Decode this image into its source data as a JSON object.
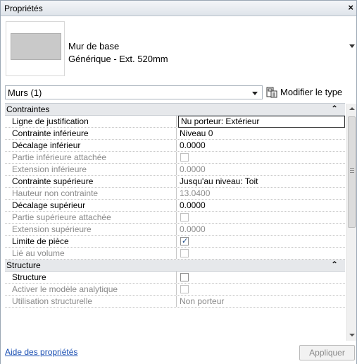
{
  "window": {
    "title": "Propriétés",
    "close_glyph": "×"
  },
  "type_selector": {
    "family": "Mur de base",
    "type": "Générique - Ext. 520mm"
  },
  "instance_filter": {
    "label": "Murs (1)"
  },
  "edit_type_button": {
    "label": "Modifier le type"
  },
  "groups": [
    {
      "name": "Contraintes",
      "collapse_glyph": "⌃"
    },
    {
      "name": "Structure",
      "collapse_glyph": "⌃"
    }
  ],
  "properties": [
    {
      "name": "Ligne de justification",
      "value": "Nu porteur: Extérieur",
      "enabled": true,
      "kind": "text"
    },
    {
      "name": "Contrainte inférieure",
      "value": "Niveau 0",
      "enabled": true,
      "kind": "text"
    },
    {
      "name": "Décalage inférieur",
      "value": "0.0000",
      "enabled": true,
      "kind": "text"
    },
    {
      "name": "Partie inférieure attachée",
      "value": "",
      "enabled": false,
      "kind": "checkbox",
      "checked": false
    },
    {
      "name": "Extension inférieure",
      "value": "0.0000",
      "enabled": false,
      "kind": "text"
    },
    {
      "name": "Contrainte supérieure",
      "value": "Jusqu'au niveau: Toit",
      "enabled": true,
      "kind": "text"
    },
    {
      "name": "Hauteur non contrainte",
      "value": "13.0400",
      "enabled": false,
      "kind": "text"
    },
    {
      "name": "Décalage supérieur",
      "value": "0.0000",
      "enabled": true,
      "kind": "text"
    },
    {
      "name": "Partie supérieure attachée",
      "value": "",
      "enabled": false,
      "kind": "checkbox",
      "checked": false
    },
    {
      "name": "Extension supérieure",
      "value": "0.0000",
      "enabled": false,
      "kind": "text"
    },
    {
      "name": "Limite de pièce",
      "value": "",
      "enabled": true,
      "kind": "checkbox",
      "checked": true
    },
    {
      "name": "Lié au volume",
      "value": "",
      "enabled": false,
      "kind": "checkbox",
      "checked": false
    },
    {
      "name": "Structure",
      "value": "",
      "enabled": true,
      "kind": "checkbox",
      "checked": false
    },
    {
      "name": "Activer le modèle analytique",
      "value": "",
      "enabled": false,
      "kind": "checkbox",
      "checked": false
    },
    {
      "name": "Utilisation structurelle",
      "value": "Non porteur",
      "enabled": false,
      "kind": "text"
    }
  ],
  "check_glyph": "✓",
  "footer": {
    "help_link": "Aide des propriétés",
    "apply_button": "Appliquer"
  },
  "colors": {
    "link": "#1a4fb3",
    "disabled_text": "#8a8a8a",
    "group_bg": "#e6e8eb"
  },
  "icons": {
    "edit_type": "edit-type-icon",
    "close": "close-icon"
  }
}
